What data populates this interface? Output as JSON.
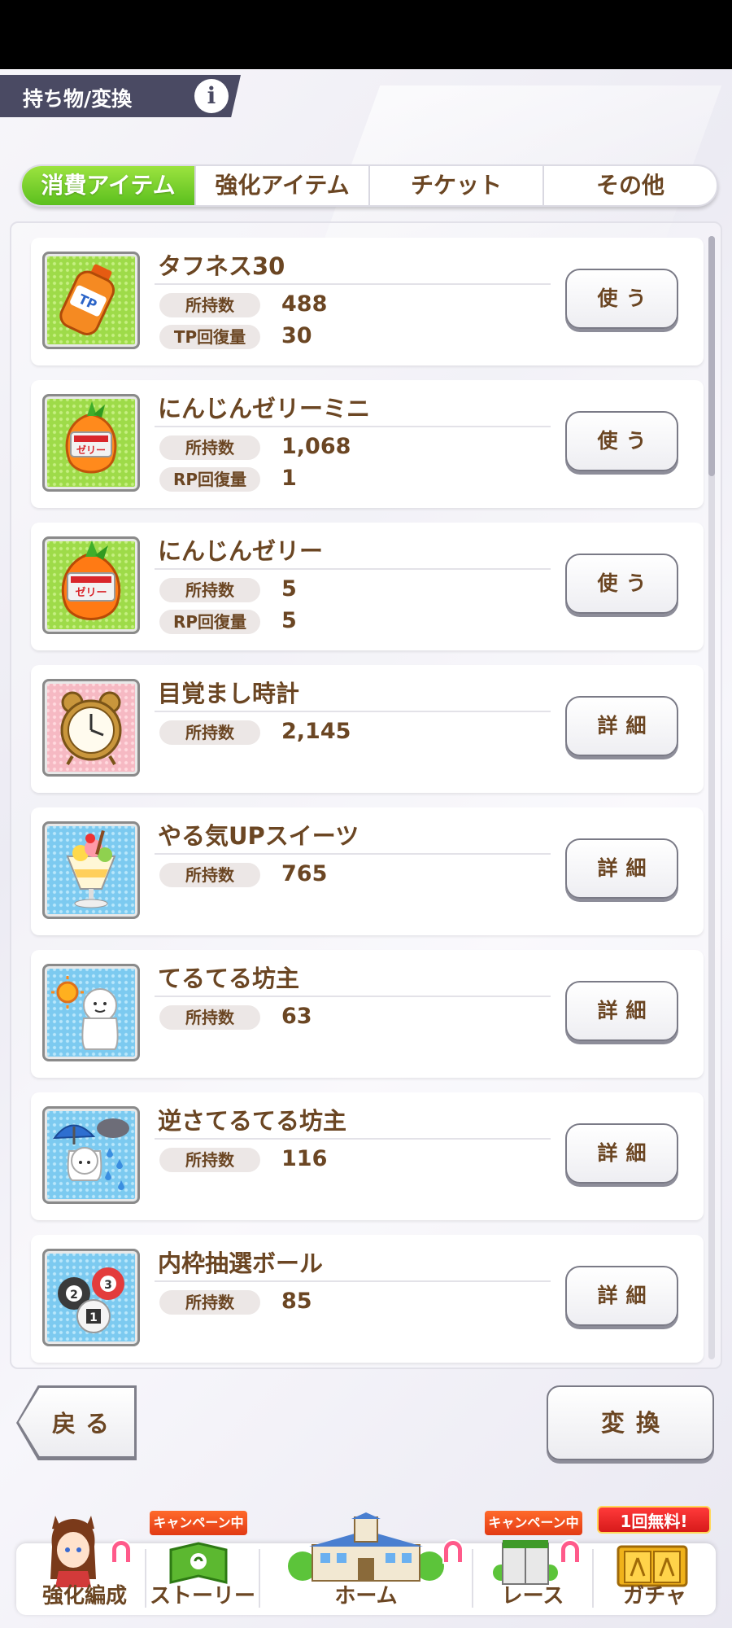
{
  "header": {
    "title": "持ち物/変換",
    "info_icon": "info-icon"
  },
  "tabs": [
    {
      "label": "消費アイテム",
      "active": true
    },
    {
      "label": "強化アイテム",
      "active": false
    },
    {
      "label": "チケット",
      "active": false
    },
    {
      "label": "その他",
      "active": false
    }
  ],
  "items": [
    {
      "name": "タフネス30",
      "icon": "tp-bottle-icon",
      "stats": [
        {
          "label": "所持数",
          "value": "488"
        },
        {
          "label": "TP回復量",
          "value": "30"
        }
      ],
      "action": "使う"
    },
    {
      "name": "にんじんゼリーミニ",
      "icon": "carrot-jelly-mini-icon",
      "stats": [
        {
          "label": "所持数",
          "value": "1,068"
        },
        {
          "label": "RP回復量",
          "value": "1"
        }
      ],
      "action": "使う"
    },
    {
      "name": "にんじんゼリー",
      "icon": "carrot-jelly-icon",
      "stats": [
        {
          "label": "所持数",
          "value": "5"
        },
        {
          "label": "RP回復量",
          "value": "5"
        }
      ],
      "action": "使う"
    },
    {
      "name": "目覚まし時計",
      "icon": "alarm-clock-icon",
      "stats": [
        {
          "label": "所持数",
          "value": "2,145"
        }
      ],
      "action": "詳細"
    },
    {
      "name": "やる気UPスイーツ",
      "icon": "parfait-icon",
      "stats": [
        {
          "label": "所持数",
          "value": "765"
        }
      ],
      "action": "詳細"
    },
    {
      "name": "てるてる坊主",
      "icon": "teru-teru-bozu-icon",
      "stats": [
        {
          "label": "所持数",
          "value": "63"
        }
      ],
      "action": "詳細"
    },
    {
      "name": "逆さてるてる坊主",
      "icon": "upside-down-teru-teru-bozu-icon",
      "stats": [
        {
          "label": "所持数",
          "value": "116"
        }
      ],
      "action": "詳細"
    },
    {
      "name": "内枠抽選ボール",
      "icon": "lottery-balls-icon",
      "stats": [
        {
          "label": "所持数",
          "value": "85"
        }
      ],
      "action": "詳細"
    }
  ],
  "footer": {
    "back_label": "戻る",
    "convert_label": "変換"
  },
  "nav": {
    "items": [
      {
        "label": "強化編成"
      },
      {
        "label": "ストーリー",
        "badge": "キャンペーン中"
      },
      {
        "label": "ホーム"
      },
      {
        "label": "レース",
        "badge": "キャンペーン中"
      },
      {
        "label": "ガチャ",
        "badge": "1回無料!"
      }
    ]
  },
  "colors": {
    "accent_green": "#6cc924",
    "text_brown": "#6b4623",
    "header_bg": "#4a4a63"
  }
}
